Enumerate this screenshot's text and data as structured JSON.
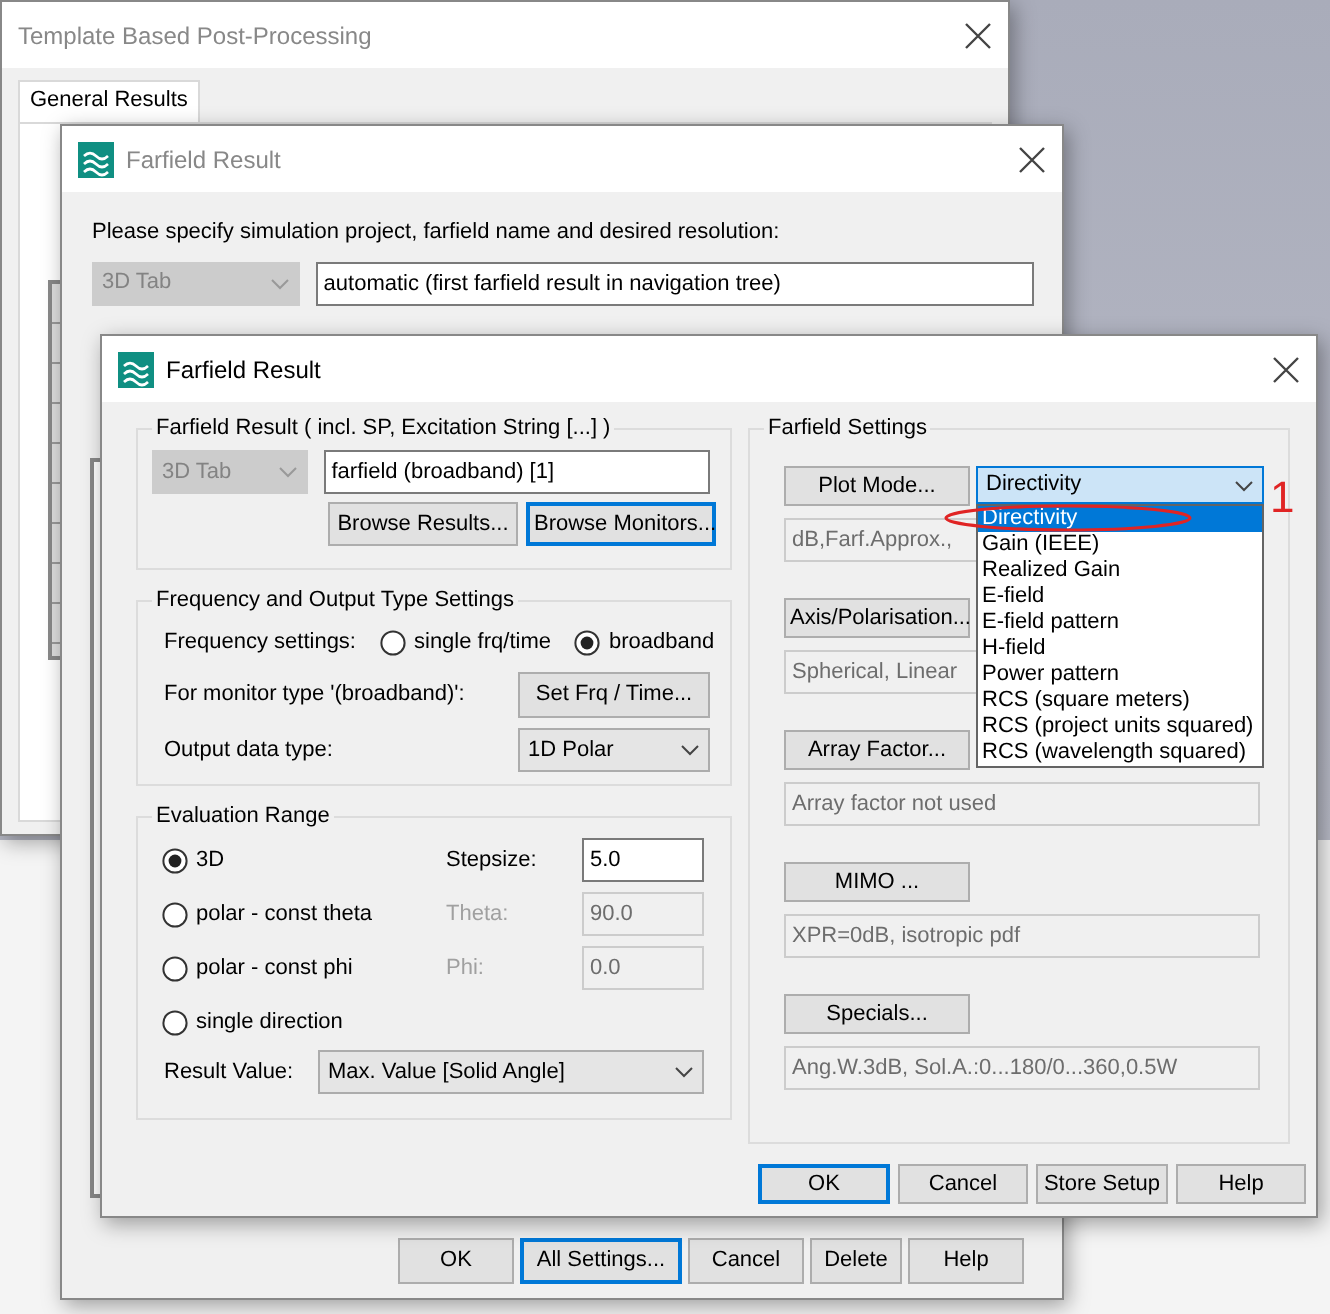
{
  "template_window": {
    "title": "Template Based Post-Processing",
    "tabs": [
      {
        "label": "General Results",
        "selected": true
      }
    ]
  },
  "back_dialog": {
    "title": "Farfield Result",
    "prompt": "Please specify simulation project, farfield name and desired resolution:",
    "type_combo": {
      "value": "3D Tab",
      "disabled": true
    },
    "farfield_field": {
      "value": "automatic (first farfield result in navigation tree)"
    },
    "buttons": [
      {
        "label": "OK",
        "focused": false
      },
      {
        "label": "All Settings...",
        "focused": true
      },
      {
        "label": "Cancel",
        "focused": false
      },
      {
        "label": "Delete",
        "focused": false
      },
      {
        "label": "Help",
        "focused": false
      }
    ]
  },
  "dialog": {
    "title": "Farfield Result",
    "result_group": {
      "title": "Farfield Result ( incl. SP, Excitation String [...] )",
      "type_combo": {
        "value": "3D Tab",
        "disabled": true
      },
      "name_field": {
        "value": "farfield (broadband) [1]"
      },
      "buttons": [
        {
          "label": "Browse Results...",
          "focused": false
        },
        {
          "label": "Browse Monitors...",
          "focused": true
        }
      ]
    },
    "frequency_group": {
      "title": "Frequency and Output Type Settings",
      "frequency_label": "Frequency settings:",
      "options": [
        {
          "label": "single frq/time",
          "selected": false
        },
        {
          "label": "broadband",
          "selected": true
        }
      ],
      "monitor_label": "For monitor type '(broadband)':",
      "set_button": "Set Frq / Time...",
      "output_label": "Output data type:",
      "output_combo": "1D Polar"
    },
    "evaluation_group": {
      "title": "Evaluation Range",
      "rows": [
        {
          "option": "3D",
          "selected": true,
          "param_label": "Stepsize:",
          "param_value": "5.0",
          "disabled": false
        },
        {
          "option": "polar - const theta",
          "selected": false,
          "param_label": "Theta:",
          "param_value": "90.0",
          "disabled": true
        },
        {
          "option": "polar - const phi",
          "selected": false,
          "param_label": "Phi:",
          "param_value": "0.0",
          "disabled": true
        },
        {
          "option": "single direction",
          "selected": false
        }
      ],
      "result_label": "Result Value:",
      "result_combo": "Max. Value [Solid Angle]"
    },
    "settings_group": {
      "title": "Farfield Settings",
      "plot_mode_combo": "Directivity",
      "rows": [
        {
          "button": "Plot Mode...",
          "summary": "dB,Farf.Approx.,"
        },
        {
          "button": "Axis/Polarisation...",
          "summary": "Spherical, Linear"
        },
        {
          "button": "Array Factor...",
          "summary": "Array factor not used"
        },
        {
          "button": "MIMO ...",
          "summary": "XPR=0dB, isotropic pdf"
        },
        {
          "button": "Specials...",
          "summary": "Ang.W.3dB, Sol.A.:0...180/0...360,0.5W"
        }
      ]
    },
    "buttons": [
      {
        "label": "OK",
        "focused": true
      },
      {
        "label": "Cancel",
        "focused": false
      },
      {
        "label": "Store Setup",
        "focused": false
      },
      {
        "label": "Help",
        "focused": false
      }
    ]
  },
  "plot_mode_dropdown": {
    "items": [
      {
        "label": "Directivity",
        "selected": true
      },
      {
        "label": "Gain (IEEE)",
        "selected": false
      },
      {
        "label": "Realized Gain",
        "selected": false
      },
      {
        "label": "E-field",
        "selected": false
      },
      {
        "label": "E-field pattern",
        "selected": false
      },
      {
        "label": "H-field",
        "selected": false
      },
      {
        "label": "Power pattern",
        "selected": false
      },
      {
        "label": "RCS (square meters)",
        "selected": false
      },
      {
        "label": "RCS (project units squared)",
        "selected": false
      },
      {
        "label": "RCS (wavelength squared)",
        "selected": false
      }
    ]
  },
  "annotation": {
    "mark": "1"
  }
}
